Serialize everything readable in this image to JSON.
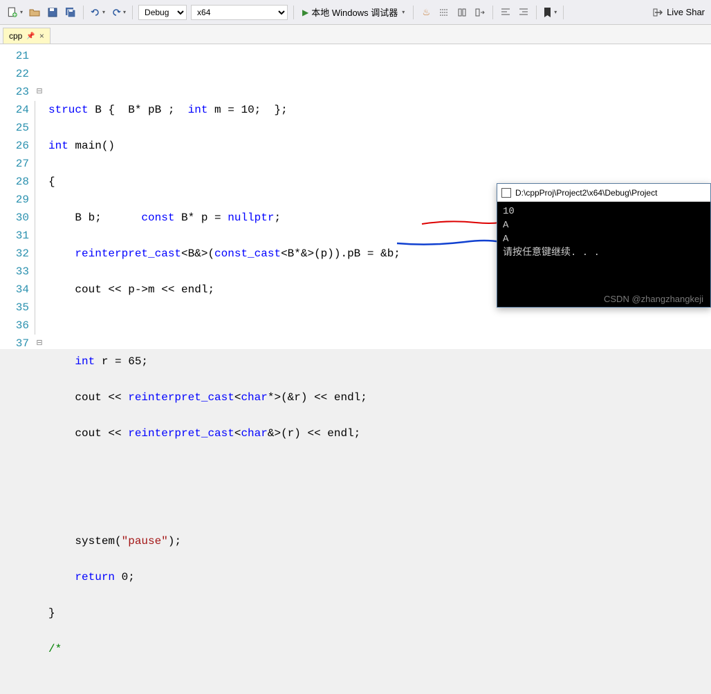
{
  "toolbar": {
    "config": "Debug",
    "platform": "x64",
    "debugger_label": "本地 Windows 调试器",
    "liveshare": "Live Shar"
  },
  "tab": {
    "name": "cpp",
    "close": "×"
  },
  "gutter": [
    "21",
    "22",
    "23",
    "24",
    "25",
    "26",
    "27",
    "28",
    "29",
    "30",
    "31",
    "32",
    "33",
    "34",
    "35",
    "36",
    "37"
  ],
  "code": {
    "l21": "",
    "l22": {
      "a": "struct",
      "b": " B {  B* pB ;  ",
      "c": "int",
      "d": " m = 10;  };"
    },
    "l23": {
      "a": "int",
      "b": " main()"
    },
    "l24": "{",
    "l25": {
      "a": "    B b;      ",
      "b": "const",
      "c": " B* p = ",
      "d": "nullptr",
      "e": ";"
    },
    "l26": {
      "a": "    ",
      "b": "reinterpret_cast",
      "c": "<B&>(",
      "d": "const_cast",
      "e": "<B*&>(p)).pB = &b;"
    },
    "l27": {
      "a": "    cout << p->m << endl;"
    },
    "l28": "",
    "l29": {
      "a": "    ",
      "b": "int",
      "c": " r = 65;"
    },
    "l30": {
      "a": "    cout << ",
      "b": "reinterpret_cast",
      "c": "<",
      "d": "char",
      "e": "*>(&r) << endl;"
    },
    "l31": {
      "a": "    cout << ",
      "b": "reinterpret_cast",
      "c": "<",
      "d": "char",
      "e": "&>(r) << endl;"
    },
    "l32": "",
    "l33": "",
    "l34": {
      "a": "    system(",
      "b": "\"pause\"",
      "c": ");"
    },
    "l35": {
      "a": "    ",
      "b": "return",
      "c": " 0;"
    },
    "l36": "}",
    "l37": "/*"
  },
  "console": {
    "title": "D:\\cppProj\\Project2\\x64\\Debug\\Project",
    "out1": "10",
    "out2": "A",
    "out3": "A",
    "out4": "请按任意键继续. . ."
  },
  "watermark": "CSDN @zhangzhangkeji"
}
